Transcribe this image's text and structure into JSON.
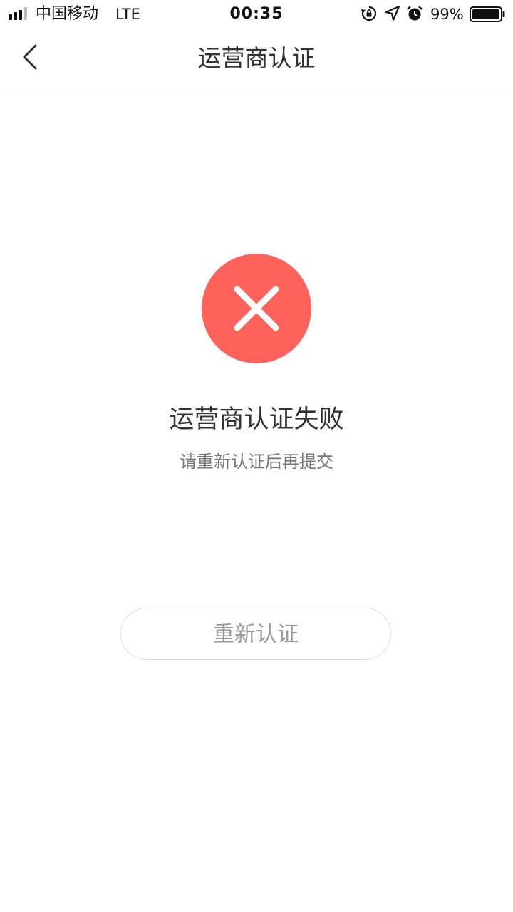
{
  "status_bar": {
    "carrier": "中国移动",
    "network": "LTE",
    "time": "00:35",
    "battery_percent": "99%",
    "battery_level": 0.99,
    "icons": [
      "signal-icon",
      "orientation-lock-icon",
      "location-icon",
      "alarm-icon",
      "battery-icon"
    ]
  },
  "nav": {
    "title": "运营商认证",
    "back_icon": "chevron-left-icon"
  },
  "result": {
    "icon": "error-x-icon",
    "icon_color": "#fe625b",
    "title": "运营商认证失败",
    "subtitle": "请重新认证后再提交"
  },
  "actions": {
    "retry_label": "重新认证"
  }
}
